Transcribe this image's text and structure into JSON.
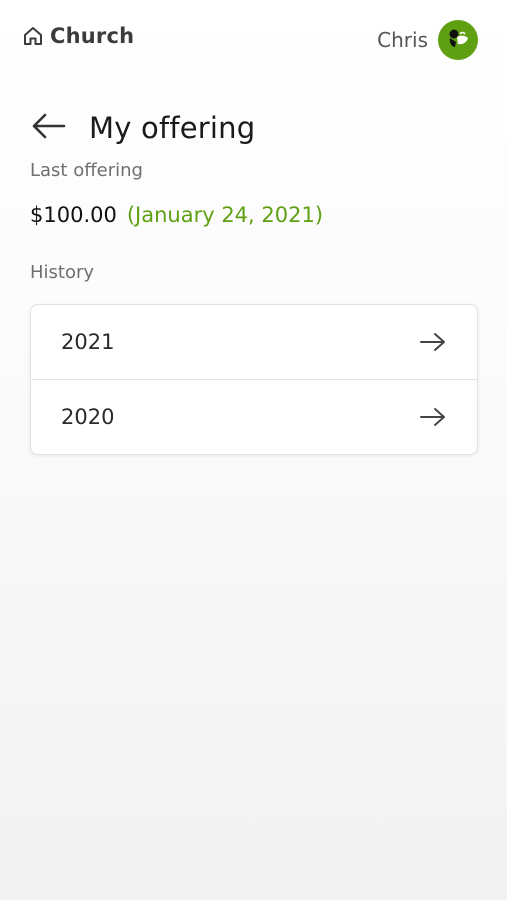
{
  "header": {
    "brand": "Church",
    "brand_icon": "home-icon",
    "user_name": "Chris",
    "avatar_icon": "avatar-icon",
    "avatar_color": "#5fa013"
  },
  "page": {
    "title": "My offering",
    "back_icon": "arrow-left-icon"
  },
  "last_offering": {
    "label": "Last offering",
    "amount": "$100.00",
    "date": "(January 24, 2021)",
    "date_color": "#5fa013"
  },
  "history": {
    "label": "History",
    "items": [
      {
        "year": "2021",
        "icon": "arrow-right-icon"
      },
      {
        "year": "2020",
        "icon": "arrow-right-icon"
      }
    ]
  }
}
